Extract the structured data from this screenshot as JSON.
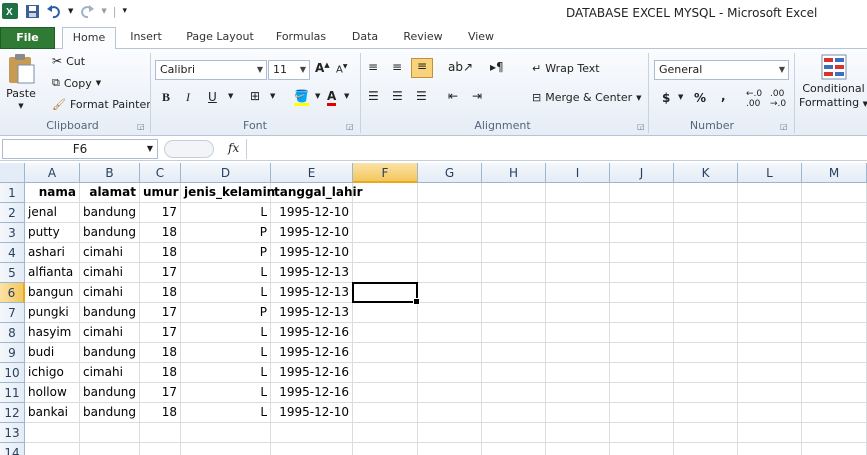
{
  "window": {
    "title": "DATABASE EXCEL MYSQL  -  Microsoft Excel"
  },
  "qat": {
    "icons": [
      "excel-logo-icon",
      "save-icon",
      "undo-icon",
      "redo-icon",
      "customize-icon"
    ]
  },
  "tabs": [
    "File",
    "Home",
    "Insert",
    "Page Layout",
    "Formulas",
    "Data",
    "Review",
    "View"
  ],
  "clipboard": {
    "paste": "Paste",
    "cut": "Cut",
    "copy": "Copy",
    "format_painter": "Format Painter",
    "label": "Clipboard"
  },
  "font": {
    "name": "Calibri",
    "size": "11",
    "label": "Font",
    "bold": "B",
    "italic": "I",
    "underline": "U"
  },
  "alignment": {
    "wrap": "Wrap Text",
    "merge": "Merge & Center",
    "label": "Alignment"
  },
  "number": {
    "format": "General",
    "currency": "$",
    "percent": "%",
    "comma": ",",
    "label": "Number"
  },
  "styles": {
    "conditional": "Conditional",
    "formatting": "Formatting"
  },
  "formula_bar": {
    "name_box": "F6",
    "fx": "fx",
    "content": ""
  },
  "columns": [
    "A",
    "B",
    "C",
    "D",
    "E",
    "F",
    "G",
    "H",
    "I",
    "J",
    "K",
    "L",
    "M"
  ],
  "rows": [
    "1",
    "2",
    "3",
    "4",
    "5",
    "6",
    "7",
    "8",
    "9",
    "10",
    "11",
    "12",
    "13",
    "14"
  ],
  "selected": {
    "column": "F",
    "row": "6"
  },
  "sheet": {
    "header": [
      "nama",
      "alamat",
      "umur",
      "jenis_kelamin",
      "tanggal_lahir"
    ],
    "data": [
      [
        "jenal",
        "bandung",
        "17",
        "L",
        "1995-12-10"
      ],
      [
        "putty",
        "bandung",
        "18",
        "P",
        "1995-12-10"
      ],
      [
        "ashari",
        "cimahi",
        "18",
        "P",
        "1995-12-10"
      ],
      [
        "alfianta",
        "cimahi",
        "17",
        "L",
        "1995-12-13"
      ],
      [
        "bangun",
        "cimahi",
        "18",
        "L",
        "1995-12-13"
      ],
      [
        "pungki",
        "bandung",
        "17",
        "P",
        "1995-12-13"
      ],
      [
        "hasyim",
        "cimahi",
        "17",
        "L",
        "1995-12-16"
      ],
      [
        "budi",
        "bandung",
        "18",
        "L",
        "1995-12-16"
      ],
      [
        "ichigo",
        "cimahi",
        "18",
        "L",
        "1995-12-16"
      ],
      [
        "hollow",
        "bandung",
        "17",
        "L",
        "1995-12-16"
      ],
      [
        "bankai",
        "bandung",
        "18",
        "L",
        "1995-12-10"
      ]
    ]
  }
}
